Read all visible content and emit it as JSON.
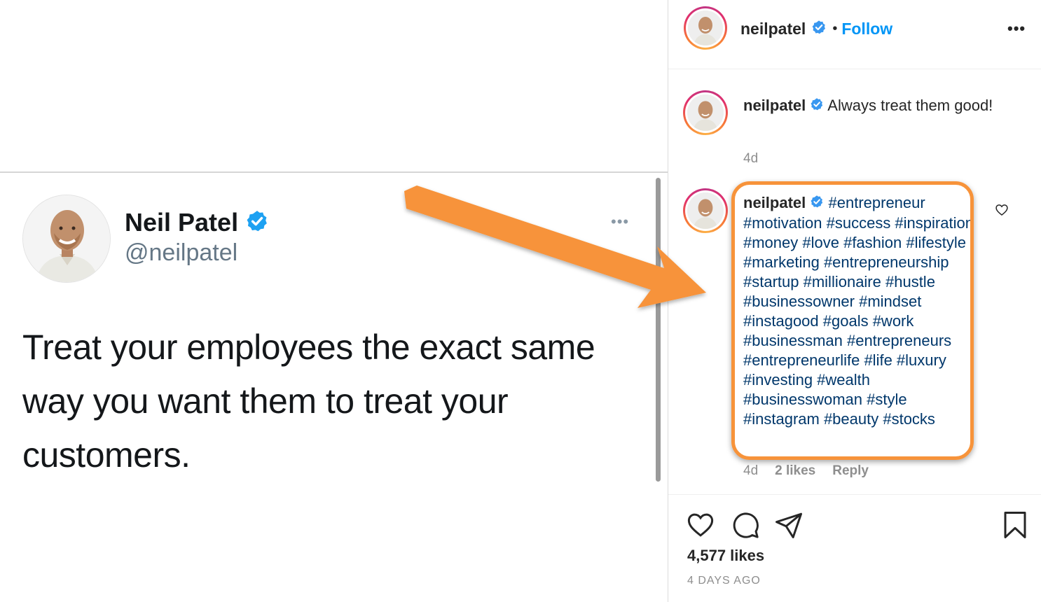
{
  "tweet": {
    "name": "Neil Patel",
    "handle": "@neilpatel",
    "text": "Treat your employees the exact same way you want them to treat your customers.",
    "more_icon": "more-horizontal-icon"
  },
  "header": {
    "username": "neilpatel",
    "separator": "•",
    "follow_label": "Follow",
    "more_label": "•••"
  },
  "caption": {
    "username": "neilpatel",
    "text": "Always treat them good!",
    "time": "4d"
  },
  "comment": {
    "username": "neilpatel",
    "hashtags": "#entrepreneur #motivation #success #inspiration #money #love #fashion #lifestyle #marketing #entrepreneurship #startup #millionaire #hustle #businessowner #mindset #instagood #goals #work #businessman #entrepreneurs #entrepreneurlife #life #luxury #investing #wealth #businesswoman #style #instagram #beauty #stocks",
    "time": "4d",
    "likes": "2 likes",
    "reply_label": "Reply"
  },
  "actions": {
    "likes_count": "4,577 likes",
    "date": "4 DAYS AGO"
  },
  "colors": {
    "accent_blue": "#0095f6",
    "hashtag_blue": "#00376b",
    "verified_blue": "#3897f0",
    "annotation_orange": "#f7933a"
  },
  "icons": [
    "verified-icon",
    "heart-icon",
    "comment-icon",
    "share-icon",
    "bookmark-icon",
    "more-horizontal-icon",
    "arrow-annotation"
  ]
}
